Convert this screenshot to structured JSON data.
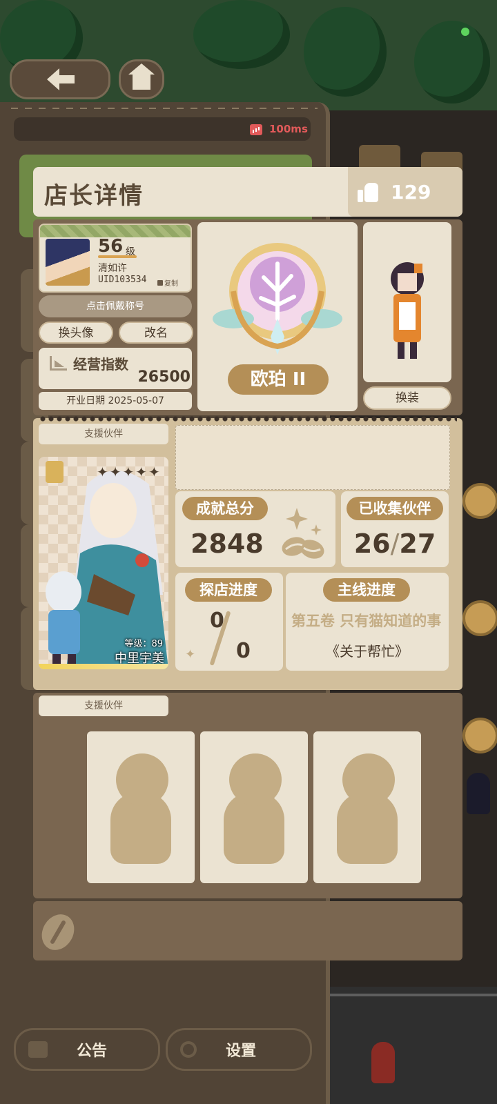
{
  "system": {
    "ping": "100ms"
  },
  "header": {
    "title": "店长详情",
    "likes": "129"
  },
  "player": {
    "level": "56",
    "level_unit": "级",
    "name": "清如许",
    "uid": "UID103534",
    "copy_label": "复制"
  },
  "actions": {
    "wear_title": "点击佩戴称号",
    "change_avatar": "换头像",
    "rename": "改名",
    "change_outfit": "换装"
  },
  "business": {
    "label": "经营指数",
    "value": "26500",
    "open_date": "开业日期 2025-05-07"
  },
  "rank": {
    "label": "欧珀 II"
  },
  "support": {
    "tab_label": "支援伙伴",
    "stars": "✦✦✦✦✦",
    "partner_level": "等级：89",
    "partner_name": "中里宇美"
  },
  "stats": {
    "achievement_label": "成就总分",
    "achievement_value": "2848",
    "collected_label": "已收集伙伴",
    "collected_value": "26",
    "collected_total": "27",
    "explore_label": "探店进度",
    "explore_value": "0",
    "explore_total": "0",
    "main_label": "主线进度",
    "main_chapter": "第五卷 只有猫知道的事",
    "main_subtitle": "《关于帮忙》"
  },
  "team": {
    "tab_label": "支援伙伴"
  },
  "footer": {
    "notice_label": "公告",
    "settings_label": "设置"
  },
  "icons": [
    "arrow-left-icon",
    "home-icon",
    "signal-icon",
    "thumb-up-icon",
    "chart-icon",
    "copy-icon",
    "edit-icon",
    "coffee-icon",
    "sparkle-icon",
    "silhouette-icon",
    "coffee-bean-icon",
    "notice-icon",
    "gear-icon"
  ],
  "colors": {
    "accent": "#b48f57",
    "panel": "#ebe3d2",
    "frame": "#7a6650",
    "ping": "#e25a5a"
  }
}
